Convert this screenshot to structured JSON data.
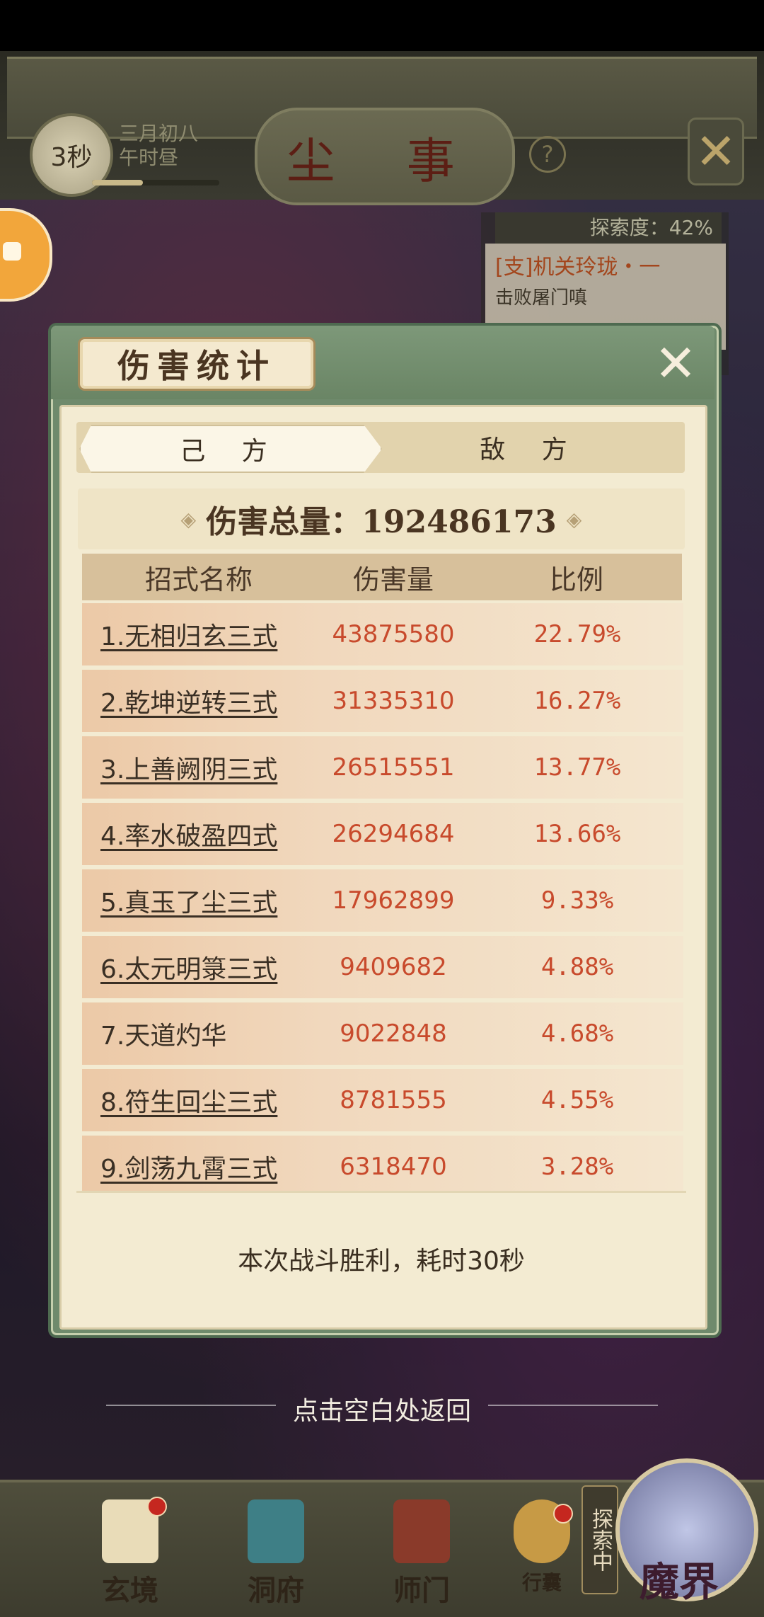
{
  "top_bar": {
    "timer": "3秒",
    "date_line1": "三月初八",
    "date_line2": "午时昼",
    "date_progress": 0.4,
    "title": "尘 事",
    "help_label": "?"
  },
  "quest": {
    "progress": "探索度：42%",
    "title": "[支]机关玲珑・一",
    "subtitle": "击败屠门嗔"
  },
  "modal": {
    "title": "伤害统计",
    "tabs": [
      {
        "label": "己 方",
        "selected": true
      },
      {
        "label": "敌 方",
        "selected": false
      }
    ],
    "total_label": "伤害总量：192486173",
    "columns": [
      "招式名称",
      "伤害量",
      "比例"
    ],
    "rows": [
      {
        "name": "1.无相归玄三式",
        "damage": "43875580",
        "ratio": "22.79%"
      },
      {
        "name": "2.乾坤逆转三式",
        "damage": "31335310",
        "ratio": "16.27%"
      },
      {
        "name": "3.上善阙阴三式",
        "damage": "26515551",
        "ratio": "13.77%"
      },
      {
        "name": "4.率水破盈四式",
        "damage": "26294684",
        "ratio": "13.66%"
      },
      {
        "name": "5.真玉了尘三式",
        "damage": "17962899",
        "ratio": "9.33%"
      },
      {
        "name": "6.太元明箓三式",
        "damage": "9409682",
        "ratio": "4.88%"
      },
      {
        "name": "7.天道灼华",
        "damage": "9022848",
        "ratio": "4.68%"
      },
      {
        "name": "8.符生回尘三式",
        "damage": "8781555",
        "ratio": "4.55%"
      },
      {
        "name": "9.剑荡九霄三式",
        "damage": "6318470",
        "ratio": "3.28%"
      }
    ],
    "footer": "本次战斗胜利，耗时30秒"
  },
  "hint": "点击空白处返回",
  "bottom_nav": {
    "items": [
      "玄境",
      "洞府",
      "师门",
      "行囊"
    ],
    "explore_tag": "探索中",
    "realm": "魔界"
  },
  "colors": {
    "damage_red": "#c84a2c",
    "modal_green": "#6f8a6c",
    "panel_cream": "#f3ebd2"
  }
}
